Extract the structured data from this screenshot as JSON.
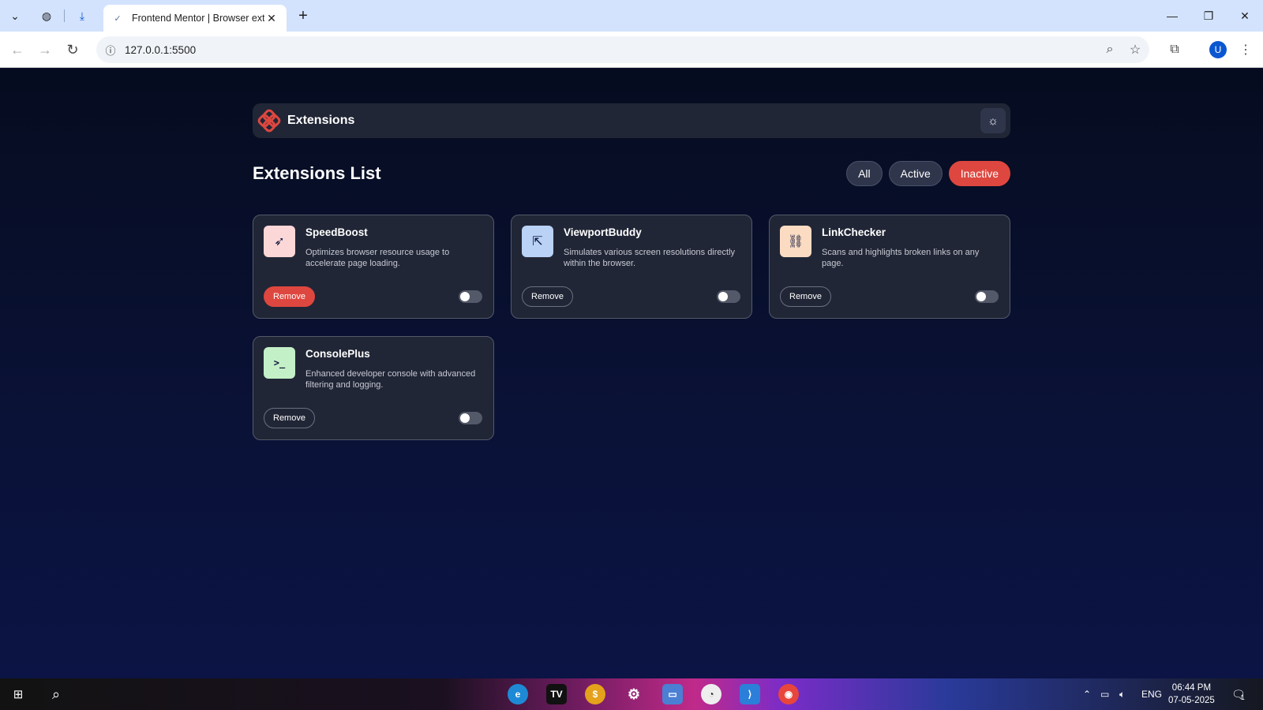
{
  "browser": {
    "tab_title": "Frontend Mentor | Browser extensions",
    "url": "127.0.0.1:5500",
    "profile_initial": "U"
  },
  "app": {
    "brand": "Extensions",
    "list_title": "Extensions List",
    "filters": [
      {
        "label": "All",
        "active": false
      },
      {
        "label": "Active",
        "active": false
      },
      {
        "label": "Inactive",
        "active": true
      }
    ],
    "remove_label": "Remove",
    "extensions": [
      {
        "name": "SpeedBoost",
        "description": "Optimizes browser resource usage to accelerate page loading.",
        "icon": "rocket-icon",
        "icon_bg": "#fbd7d7",
        "enabled": false
      },
      {
        "name": "ViewportBuddy",
        "description": "Simulates various screen resolutions directly within the browser.",
        "icon": "external-link-icon",
        "icon_bg": "#b9d2f5",
        "enabled": false
      },
      {
        "name": "LinkChecker",
        "description": "Scans and highlights broken links on any page.",
        "icon": "broken-link-icon",
        "icon_bg": "#fbdcc3",
        "enabled": false
      },
      {
        "name": "ConsolePlus",
        "description": "Enhanced developer console with advanced filtering and logging.",
        "icon": "terminal-icon",
        "icon_bg": "#c4f0c8",
        "enabled": false
      }
    ]
  },
  "taskbar": {
    "language": "ENG",
    "time": "06:44 PM",
    "date": "07-05-2025",
    "notification_count": "1"
  },
  "colors": {
    "accent": "#de473f",
    "card_bg": "#212636",
    "page_bg": "#0a1238"
  }
}
